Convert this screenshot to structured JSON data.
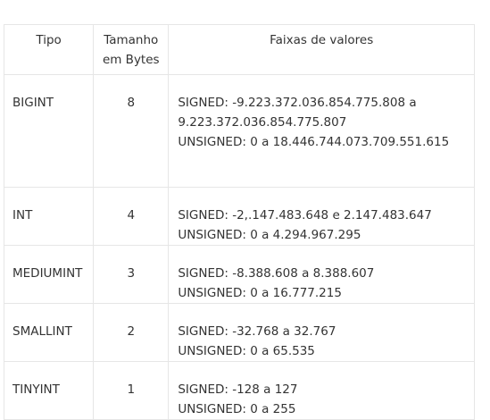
{
  "headers": {
    "type": "Tipo",
    "size_line1": "Tamanho",
    "size_line2": "em Bytes",
    "range": "Faixas de valores"
  },
  "rows": [
    {
      "type": "BIGINT",
      "size": "8",
      "range_lines": [
        "SIGNED: -9.223.372.036.854.775.808 a",
        "9.223.372.036.854.775.807",
        "UNSIGNED: 0 a 18.446.744.073.709.551.615"
      ]
    },
    {
      "type": "INT",
      "size": "4",
      "range_lines": [
        "SIGNED: -2,.147.483.648 e 2.147.483.647",
        "UNSIGNED: 0 a 4.294.967.295"
      ]
    },
    {
      "type": "MEDIUMINT",
      "size": "3",
      "range_lines": [
        "SIGNED: -8.388.608 a 8.388.607",
        "UNSIGNED:  0 a 16.777.215"
      ]
    },
    {
      "type": "SMALLINT",
      "size": "2",
      "range_lines": [
        "SIGNED: -32.768 a 32.767",
        "UNSIGNED:  0 a 65.535"
      ]
    },
    {
      "type": "TINYINT",
      "size": "1",
      "range_lines": [
        "SIGNED: -128 a 127",
        "UNSIGNED:  0 a 255"
      ]
    }
  ]
}
